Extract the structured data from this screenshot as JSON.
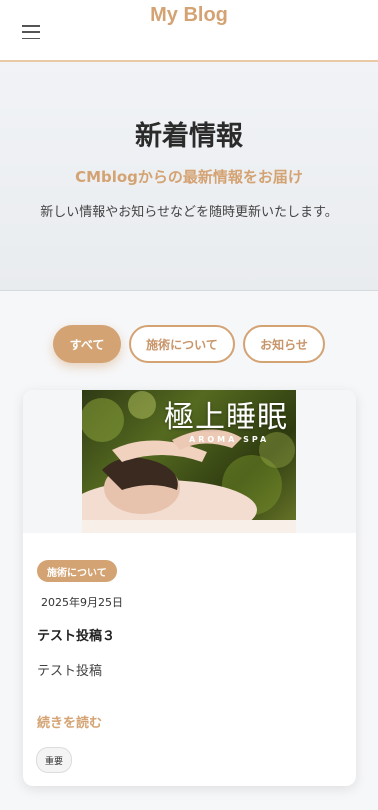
{
  "header": {
    "title": "My Blog",
    "menu_icon": "hamburger-menu-icon"
  },
  "hero": {
    "title": "新着情報",
    "subtitle": "CMblogからの最新情報をお届け",
    "description": "新しい情報やお知らせなどを随時更新いたします。"
  },
  "filters": [
    {
      "label": "すべて",
      "active": true
    },
    {
      "label": "施術について",
      "active": false
    },
    {
      "label": "お知らせ",
      "active": false
    }
  ],
  "post": {
    "image_title": "極上睡眠",
    "image_subtitle": "AROMA SPA",
    "category": "施術について",
    "date": "2025年9月25日",
    "title": "テスト投稿３",
    "excerpt": "テスト投稿",
    "read_more": "続きを読む",
    "tag": "重要"
  },
  "colors": {
    "accent": "#d4a373",
    "header_bg": "#ffffff",
    "page_bg": "#f6f7f9"
  }
}
